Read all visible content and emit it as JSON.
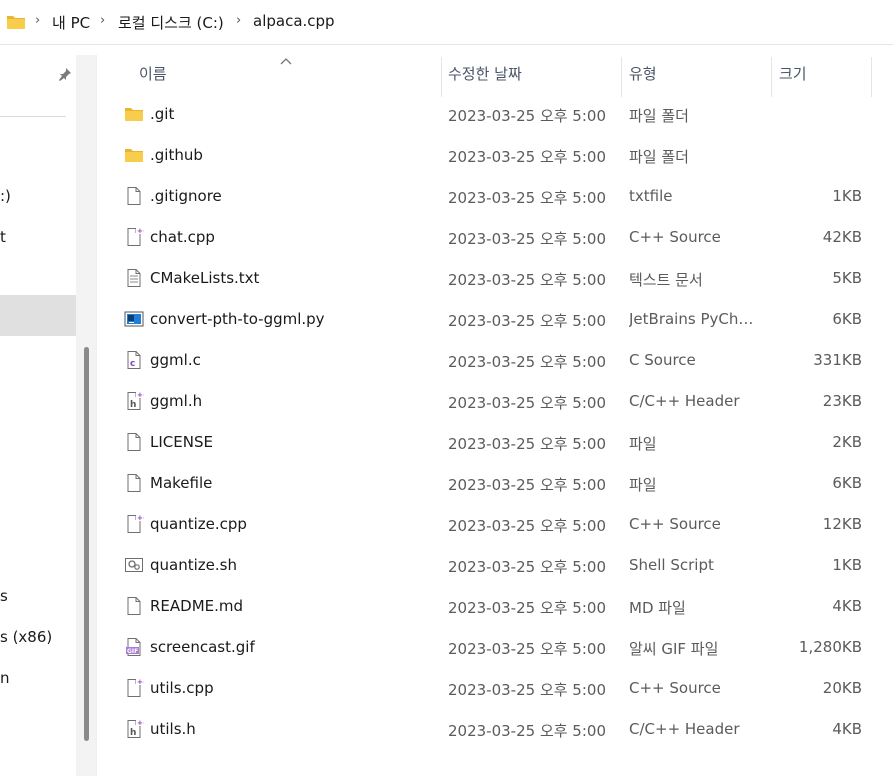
{
  "breadcrumb": {
    "items": [
      "내 PC",
      "로컬 디스크 (C:)",
      "alpaca.cpp"
    ],
    "separator": "›"
  },
  "nav": {
    "items": [
      ":)",
      "t",
      "s",
      "s (x86)",
      "n"
    ]
  },
  "columns": {
    "name": "이름",
    "date": "수정한 날짜",
    "type": "유형",
    "size": "크기"
  },
  "files": [
    {
      "name": ".git",
      "date": "2023-03-25 오후 5:00",
      "type": "파일 폴더",
      "size": "",
      "icon": "folder-icon"
    },
    {
      "name": ".github",
      "date": "2023-03-25 오후 5:00",
      "type": "파일 폴더",
      "size": "",
      "icon": "folder-icon"
    },
    {
      "name": ".gitignore",
      "date": "2023-03-25 오후 5:00",
      "type": "txtfile",
      "size": "1KB",
      "icon": "file-icon"
    },
    {
      "name": "chat.cpp",
      "date": "2023-03-25 오후 5:00",
      "type": "C++ Source",
      "size": "42KB",
      "icon": "cpp-file-icon"
    },
    {
      "name": "CMakeLists.txt",
      "date": "2023-03-25 오후 5:00",
      "type": "텍스트 문서",
      "size": "5KB",
      "icon": "text-file-icon"
    },
    {
      "name": "convert-pth-to-ggml.py",
      "date": "2023-03-25 오후 5:00",
      "type": "JetBrains PyCharm...",
      "size": "6KB",
      "icon": "pycharm-file-icon"
    },
    {
      "name": "ggml.c",
      "date": "2023-03-25 오후 5:00",
      "type": "C Source",
      "size": "331KB",
      "icon": "c-file-icon"
    },
    {
      "name": "ggml.h",
      "date": "2023-03-25 오후 5:00",
      "type": "C/C++ Header",
      "size": "23KB",
      "icon": "header-file-icon"
    },
    {
      "name": "LICENSE",
      "date": "2023-03-25 오후 5:00",
      "type": "파일",
      "size": "2KB",
      "icon": "file-icon"
    },
    {
      "name": "Makefile",
      "date": "2023-03-25 오후 5:00",
      "type": "파일",
      "size": "6KB",
      "icon": "file-icon"
    },
    {
      "name": "quantize.cpp",
      "date": "2023-03-25 오후 5:00",
      "type": "C++ Source",
      "size": "12KB",
      "icon": "cpp-file-icon"
    },
    {
      "name": "quantize.sh",
      "date": "2023-03-25 오후 5:00",
      "type": "Shell Script",
      "size": "1KB",
      "icon": "shell-script-icon"
    },
    {
      "name": "README.md",
      "date": "2023-03-25 오후 5:00",
      "type": "MD 파일",
      "size": "4KB",
      "icon": "file-icon"
    },
    {
      "name": "screencast.gif",
      "date": "2023-03-25 오후 5:00",
      "type": "알씨 GIF 파일",
      "size": "1,280KB",
      "icon": "gif-file-icon"
    },
    {
      "name": "utils.cpp",
      "date": "2023-03-25 오후 5:00",
      "type": "C++ Source",
      "size": "20KB",
      "icon": "cpp-file-icon"
    },
    {
      "name": "utils.h",
      "date": "2023-03-25 오후 5:00",
      "type": "C/C++ Header",
      "size": "4KB",
      "icon": "header-file-icon"
    }
  ],
  "colors": {
    "folder": "#F4C542",
    "accent_purple": "#8B3FBF",
    "selection": "#E0E0E0",
    "header_text": "#4A5568"
  }
}
